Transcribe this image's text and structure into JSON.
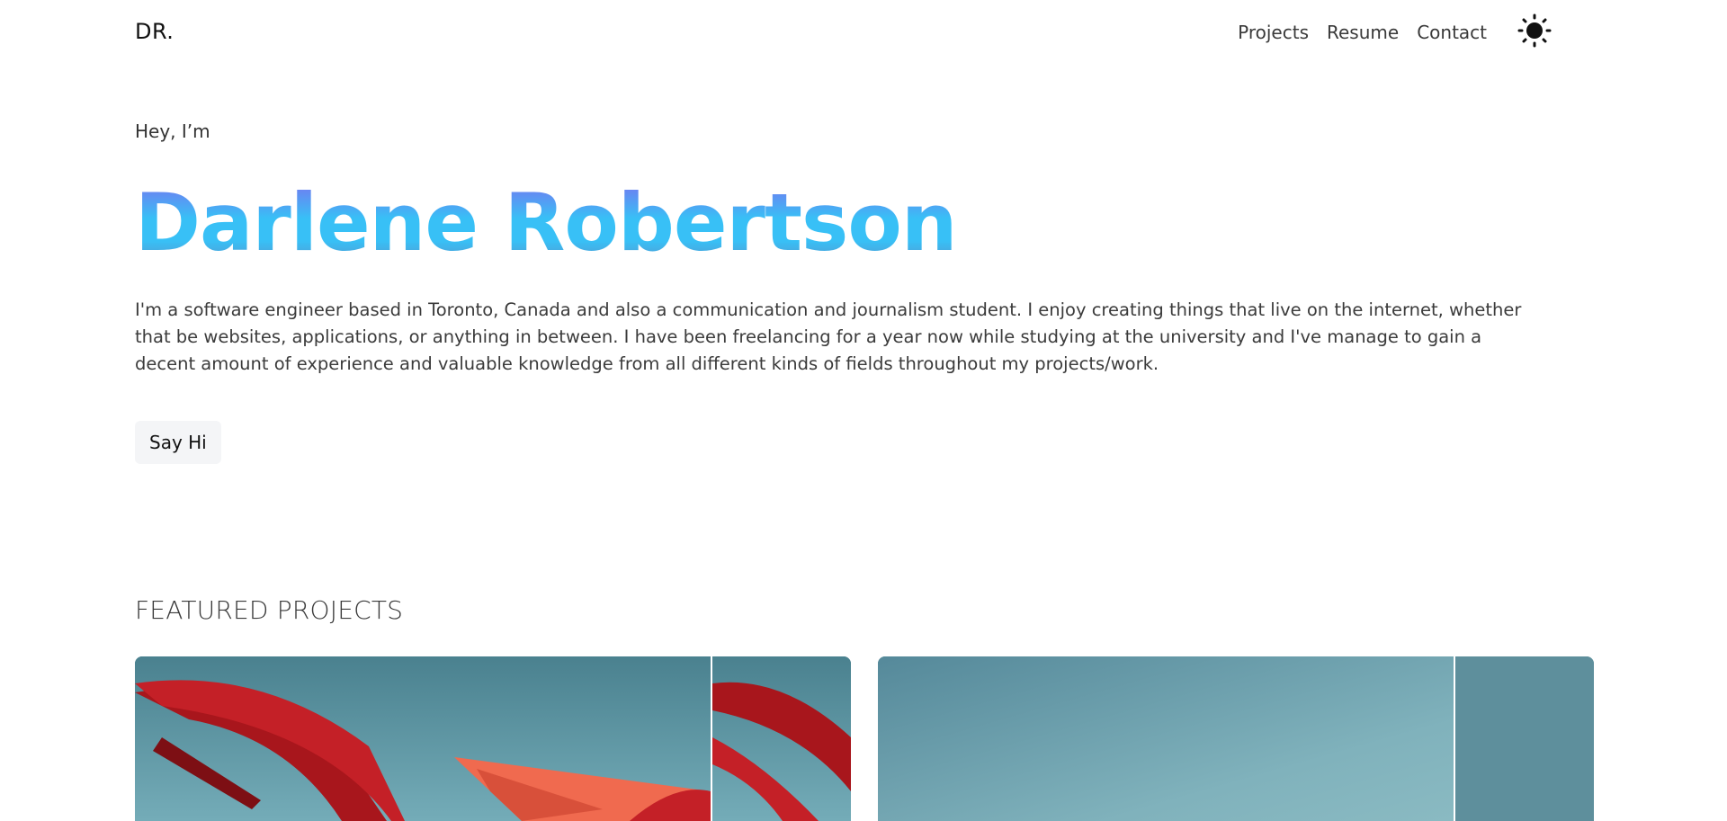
{
  "nav": {
    "logo": "DR.",
    "links": [
      {
        "label": "Projects"
      },
      {
        "label": "Resume"
      },
      {
        "label": "Contact"
      }
    ],
    "theme_icon": "sun-icon"
  },
  "hero": {
    "greeting": "Hey, I’m",
    "name": "Darlene Robertson",
    "intro": "I'm a software engineer based in Toronto, Canada and also a communication and journalism student. I enjoy creating things that live on the internet, whether that be websites, applications, or anything in between. I have been freelancing for a year now while studying at the university and I've manage to gain a decent amount of experience and valuable knowledge from all different kinds of fields throughout my projects/work.",
    "cta_label": "Say Hi"
  },
  "featured": {
    "title": "FEATURED PROJECTS"
  },
  "colors": {
    "name_gradient_top": "#7b6ff0",
    "name_gradient_mid": "#38c0f6",
    "card_sky": "#4b8391",
    "sculpture_red": "#a8161c",
    "sculpture_orange": "#f06a4f"
  }
}
